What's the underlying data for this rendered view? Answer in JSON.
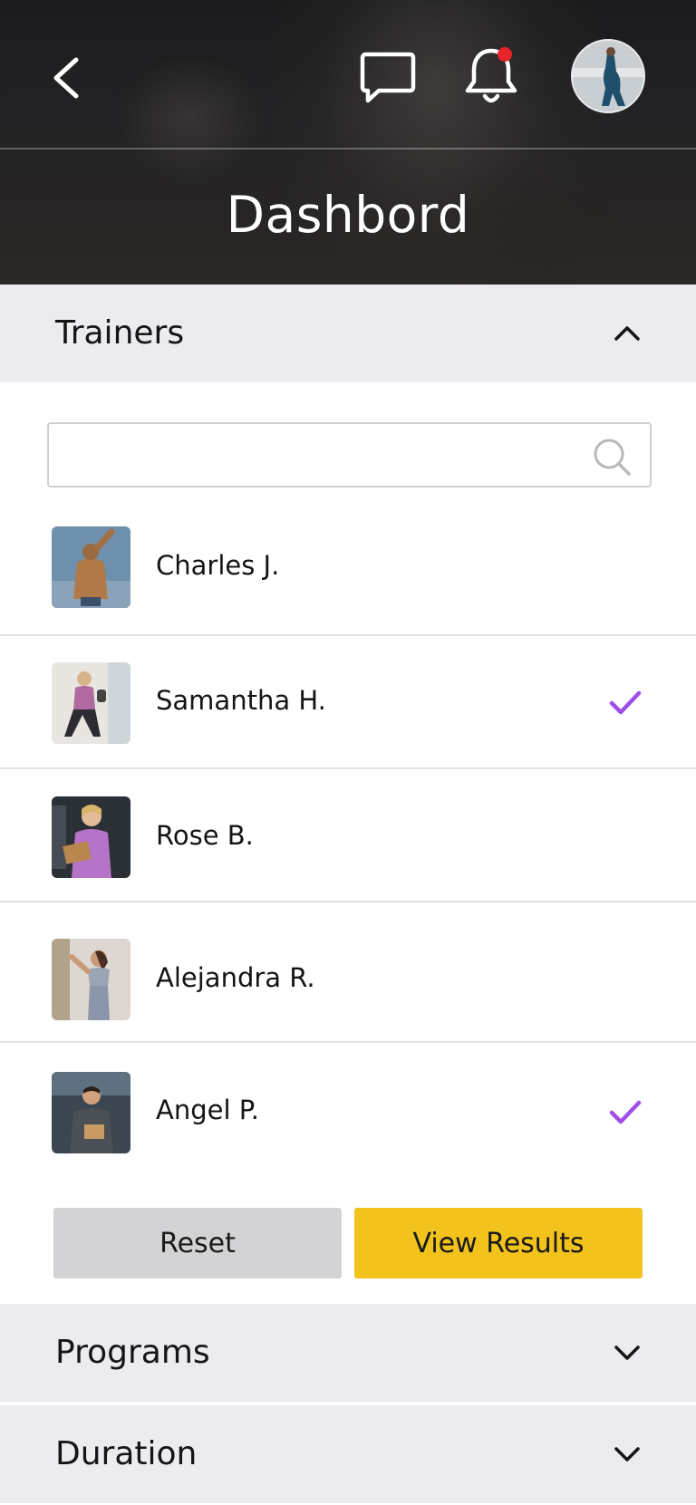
{
  "header": {
    "title": "Dashbord",
    "back_icon": "chevron-left-icon",
    "chat_icon": "chat-bubble-icon",
    "bell_icon": "bell-icon",
    "has_notification": true
  },
  "sections": {
    "trainers": {
      "label": "Trainers",
      "expanded": true
    },
    "programs": {
      "label": "Programs",
      "expanded": false
    },
    "duration": {
      "label": "Duration",
      "expanded": false
    }
  },
  "search": {
    "value": "",
    "placeholder": ""
  },
  "trainers": [
    {
      "name": "Charles J.",
      "selected": false
    },
    {
      "name": "Samantha H.",
      "selected": true
    },
    {
      "name": "Rose B.",
      "selected": false
    },
    {
      "name": "Alejandra R.",
      "selected": false
    },
    {
      "name": "Angel P.",
      "selected": true
    }
  ],
  "actions": {
    "reset_label": "Reset",
    "view_results_label": "View Results"
  },
  "colors": {
    "accent_check": "#a04ee8",
    "primary_button": "#f2c21d",
    "secondary_button": "#d3d3d5",
    "notification_dot": "#e8242a"
  }
}
